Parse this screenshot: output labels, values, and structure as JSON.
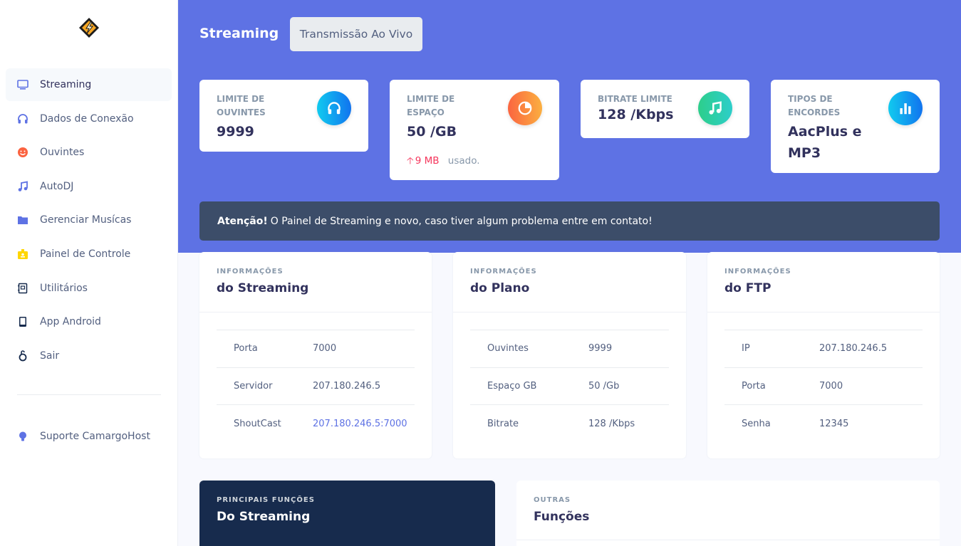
{
  "sidebar": {
    "logo": "winamp-lightning-icon",
    "items": [
      {
        "label": "Streaming",
        "icon": "monitor-icon",
        "color": "#5e72e4",
        "active": true
      },
      {
        "label": "Dados de Conexão",
        "icon": "headphones-icon",
        "color": "#5e72e4"
      },
      {
        "label": "Ouvintes",
        "icon": "smile-icon",
        "color": "#fb6340"
      },
      {
        "label": "AutoDJ",
        "icon": "music-icon",
        "color": "#5e72e4"
      },
      {
        "label": "Gerenciar Musícas",
        "icon": "folder-icon",
        "color": "#5e72e4"
      },
      {
        "label": "Painel de Controle",
        "icon": "badge-icon",
        "color": "#ffd600"
      },
      {
        "label": "Utilitários",
        "icon": "book-icon",
        "color": "#172b4d"
      },
      {
        "label": "App Android",
        "icon": "mobile-icon",
        "color": "#172b4d"
      },
      {
        "label": "Sair",
        "icon": "power-icon",
        "color": "#172b4d"
      }
    ],
    "support": {
      "label": "Suporte CamargoHost",
      "icon": "bulb-icon",
      "color": "#5e72e4"
    }
  },
  "header": {
    "title": "Streaming",
    "live_button": "Transmissão Ao Vivo",
    "bg": "#5e72e4"
  },
  "stats": [
    {
      "label": "Limite de Ouvintes",
      "value": "9999",
      "icon": "headphones-icon",
      "grad": "linear-gradient(87deg,#11cdef,#1171ef)"
    },
    {
      "label": "Limite de Espaço",
      "value": "50 /GB",
      "icon": "pie-chart-icon",
      "grad": "linear-gradient(87deg,#fb6340,#fbb140)",
      "foot_value": "9 MB",
      "foot_text": "usado."
    },
    {
      "label": "Bitrate Limite",
      "value": "128 /Kbps",
      "icon": "music-note-icon",
      "grad": "linear-gradient(87deg,#2dce89,#2dcecc)"
    },
    {
      "label": "Tipos de Encordes",
      "value": "AacPlus e MP3",
      "icon": "bar-chart-icon",
      "grad": "linear-gradient(87deg,#11cdef,#1171ef)"
    }
  ],
  "alert": {
    "strong": "Atenção!",
    "text": "O Painel de Streaming e novo, caso tiver algum problema entre em contato!"
  },
  "info_cards": [
    {
      "sub": "Informações",
      "title": "do Streaming",
      "rows": [
        {
          "k": "Porta",
          "v": "7000"
        },
        {
          "k": "Servidor",
          "v": "207.180.246.5"
        },
        {
          "k": "ShoutCast",
          "v": "207.180.246.5:7000",
          "link": true
        }
      ]
    },
    {
      "sub": "Informações",
      "title": "do Plano",
      "rows": [
        {
          "k": "Ouvintes",
          "v": "9999"
        },
        {
          "k": "Espaço GB",
          "v": "50 /Gb"
        },
        {
          "k": "Bitrate",
          "v": "128 /Kbps"
        }
      ]
    },
    {
      "sub": "Informações",
      "title": "do FTP",
      "rows": [
        {
          "k": "IP",
          "v": "207.180.246.5"
        },
        {
          "k": "Porta",
          "v": "7000"
        },
        {
          "k": "Senha",
          "v": "12345"
        }
      ]
    }
  ],
  "bottom_cards": [
    {
      "sub": "Principais Funções",
      "title": "Do Streaming"
    },
    {
      "sub": "Outras",
      "title": "Funções"
    }
  ]
}
